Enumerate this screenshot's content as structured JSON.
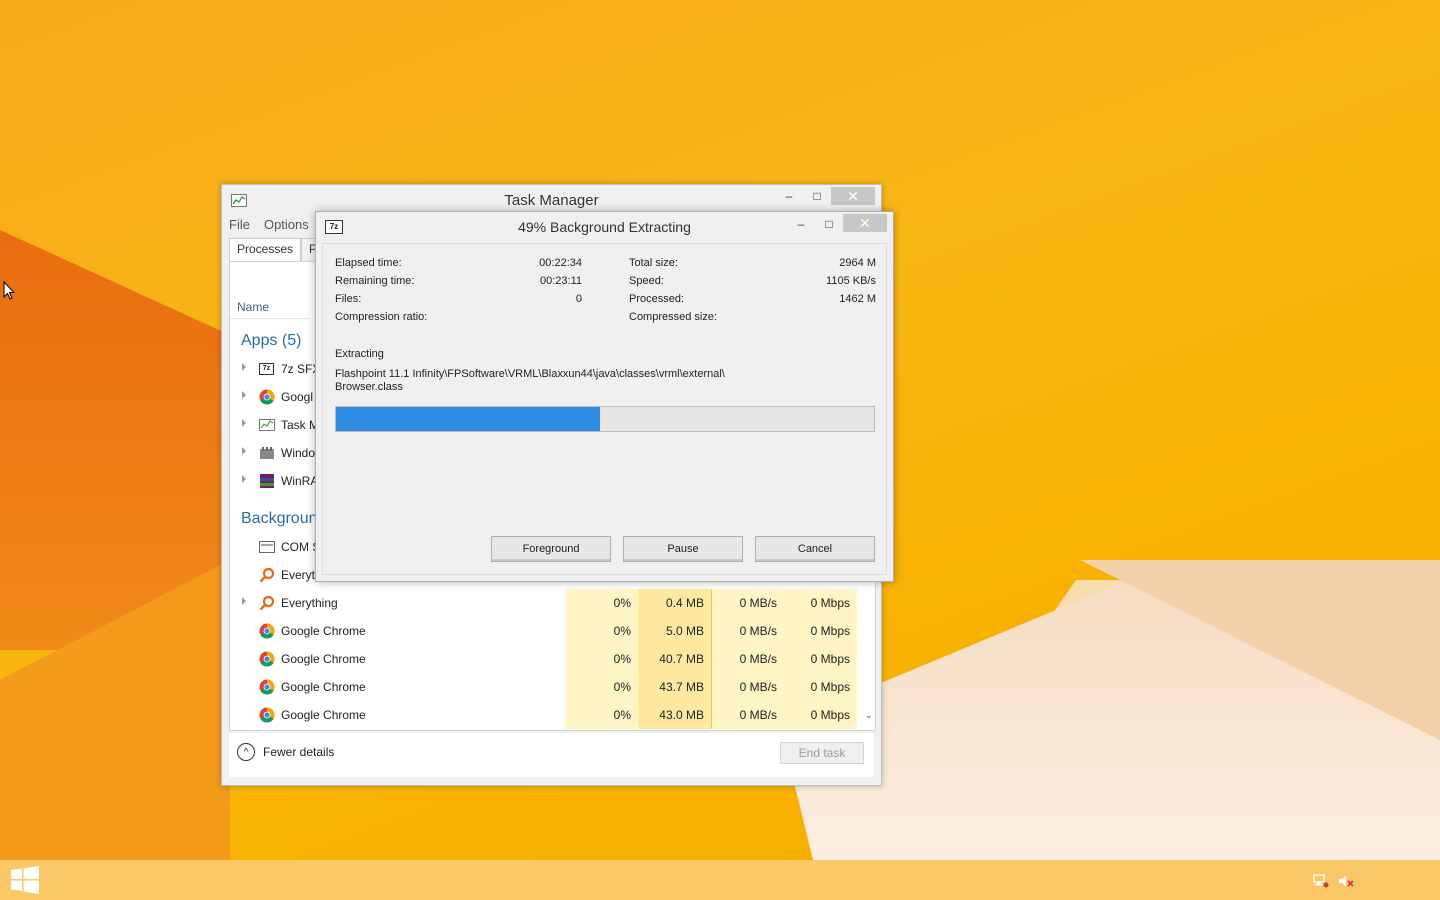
{
  "taskmanager": {
    "title": "Task Manager",
    "menu": [
      "File",
      "Options"
    ],
    "tabs": [
      "Processes",
      "Pe"
    ],
    "column_name": "Name",
    "group_apps": "Apps (5)",
    "group_background": "Backgroun",
    "apps": [
      "7z SFX",
      "Googl",
      "Task M",
      "Windo",
      "WinRA"
    ],
    "background": [
      "COM S",
      "Everyt"
    ],
    "rows": [
      {
        "name": "Everything",
        "cpu": "0%",
        "mem": "0.4 MB",
        "disk": "0 MB/s",
        "net": "0 Mbps"
      },
      {
        "name": "Google Chrome",
        "cpu": "0%",
        "mem": "5.0 MB",
        "disk": "0 MB/s",
        "net": "0 Mbps"
      },
      {
        "name": "Google Chrome",
        "cpu": "0%",
        "mem": "40.7 MB",
        "disk": "0 MB/s",
        "net": "0 Mbps"
      },
      {
        "name": "Google Chrome",
        "cpu": "0%",
        "mem": "43.7 MB",
        "disk": "0 MB/s",
        "net": "0 Mbps"
      },
      {
        "name": "Google Chrome",
        "cpu": "0%",
        "mem": "43.0 MB",
        "disk": "0 MB/s",
        "net": "0 Mbps"
      }
    ],
    "fewer_details": "Fewer details",
    "end_task": "End task"
  },
  "extract": {
    "title": "49% Background Extracting",
    "icon_text": "7z",
    "progress": 0.49,
    "elapsed_label": "Elapsed time:",
    "elapsed": "00:22:34",
    "remaining_label": "Remaining time:",
    "remaining": "00:23:11",
    "files_label": "Files:",
    "files": "0",
    "ratio_label": "Compression ratio:",
    "total_label": "Total size:",
    "total": "2964 M",
    "speed_label": "Speed:",
    "speed": "1105 KB/s",
    "processed_label": "Processed:",
    "processed": "1462 M",
    "compressed_label": "Compressed size:",
    "extracting_label": "Extracting",
    "path_line1": "Flashpoint 11.1 Infinity\\FPSoftware\\VRML\\Blaxxun44\\java\\classes\\vrml\\external\\",
    "path_line2": "Browser.class",
    "buttons": {
      "foreground": "Foreground",
      "pause": "Pause",
      "cancel": "Cancel"
    }
  },
  "window_controls": {
    "minimize": "–",
    "maximize": "□",
    "close": "✕"
  },
  "colors": {
    "accent": "#2f8ee4",
    "link": "#2a6ea8",
    "highlight": "#fff4c4"
  }
}
